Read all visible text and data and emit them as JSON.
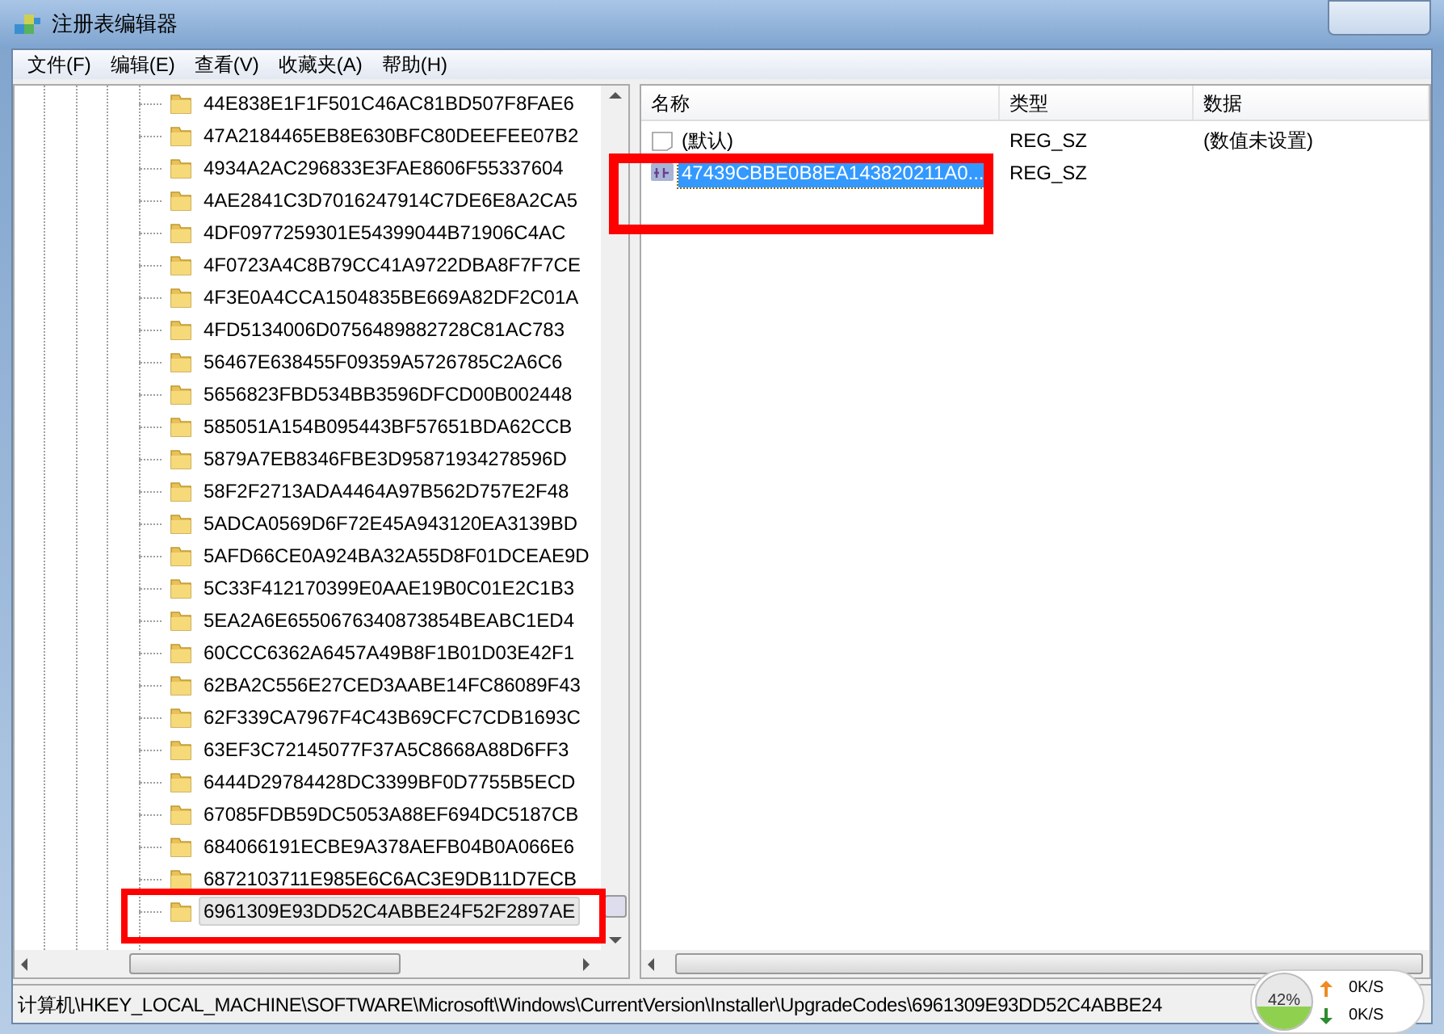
{
  "window": {
    "title": "注册表编辑器"
  },
  "menu": [
    "文件(F)",
    "编辑(E)",
    "查看(V)",
    "收藏夹(A)",
    "帮助(H)"
  ],
  "tree": {
    "items": [
      {
        "label": "44E838E1F1F501C46AC81BD507F8FAE6",
        "selected": false
      },
      {
        "label": "47A2184465EB8E630BFC80DEEFEE07B2",
        "selected": false
      },
      {
        "label": "4934A2AC296833E3FAE8606F55337604",
        "selected": false
      },
      {
        "label": "4AE2841C3D7016247914C7DE6E8A2CA5",
        "selected": false
      },
      {
        "label": "4DF0977259301E54399044B71906C4AC",
        "selected": false
      },
      {
        "label": "4F0723A4C8B79CC41A9722DBA8F7F7CE",
        "selected": false
      },
      {
        "label": "4F3E0A4CCA1504835BE669A82DF2C01A",
        "selected": false
      },
      {
        "label": "4FD5134006D0756489882728C81AC783",
        "selected": false
      },
      {
        "label": "56467E638455F09359A5726785C2A6C6",
        "selected": false
      },
      {
        "label": "5656823FBD534BB3596DFCD00B002448",
        "selected": false
      },
      {
        "label": "585051A154B095443BF57651BDA62CCB",
        "selected": false
      },
      {
        "label": "5879A7EB8346FBE3D95871934278596D",
        "selected": false
      },
      {
        "label": "58F2F2713ADA4464A97B562D757E2F48",
        "selected": false
      },
      {
        "label": "5ADCA0569D6F72E45A943120EA3139BD",
        "selected": false
      },
      {
        "label": "5AFD66CE0A924BA32A55D8F01DCEAE9D",
        "selected": false
      },
      {
        "label": "5C33F412170399E0AAE19B0C01E2C1B3",
        "selected": false
      },
      {
        "label": "5EA2A6E6550676340873854BEABC1ED4",
        "selected": false
      },
      {
        "label": "60CCC6362A6457A49B8F1B01D03E42F1",
        "selected": false
      },
      {
        "label": "62BA2C556E27CED3AABE14FC86089F43",
        "selected": false
      },
      {
        "label": "62F339CA7967F4C43B69CFC7CDB1693C",
        "selected": false
      },
      {
        "label": "63EF3C72145077F37A5C8668A88D6FF3",
        "selected": false
      },
      {
        "label": "6444D29784428DC3399BF0D7755B5ECD",
        "selected": false
      },
      {
        "label": "67085FDB59DC5053A88EF694DC5187CB",
        "selected": false
      },
      {
        "label": "684066191ECBE9A378AEFB04B0A066E6",
        "selected": false
      },
      {
        "label": "6872103711E985E6C6AC3E9DB11D7ECB",
        "selected": false
      },
      {
        "label": "6961309E93DD52C4ABBE24F52F2897AE",
        "selected": true
      }
    ]
  },
  "values": {
    "columns": [
      "名称",
      "类型",
      "数据"
    ],
    "rows": [
      {
        "kind": "default",
        "name": "(默认)",
        "type": "REG_SZ",
        "data": "(数值未设置)",
        "selected": false
      },
      {
        "kind": "string",
        "name": "47439CBBE0B8EA143820211A0...",
        "type": "REG_SZ",
        "selected": true
      }
    ]
  },
  "status_bar": {
    "path": "计算机\\HKEY_LOCAL_MACHINE\\SOFTWARE\\Microsoft\\Windows\\CurrentVersion\\Installer\\UpgradeCodes\\6961309E93DD52C4ABBE24"
  },
  "network_widget": {
    "percent": "42%",
    "upload": "0K/S",
    "download": "0K/S"
  }
}
